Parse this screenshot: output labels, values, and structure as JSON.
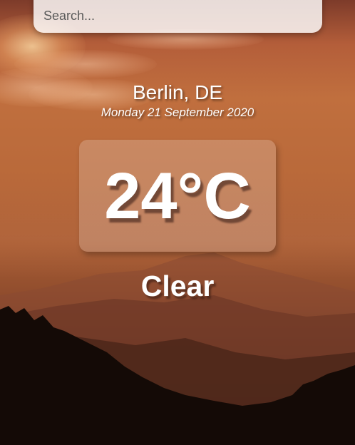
{
  "search": {
    "placeholder": "Search...",
    "value": ""
  },
  "location": {
    "city_country": "Berlin, DE",
    "date": "Monday 21 September 2020"
  },
  "weather": {
    "temperature": "24°C",
    "condition": "Clear"
  },
  "colors": {
    "text": "#ffffff",
    "search_bg": "#ffffffd1",
    "temp_box_bg": "#ffffff33"
  }
}
